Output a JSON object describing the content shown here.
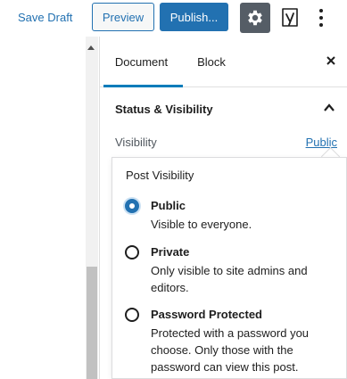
{
  "toolbar": {
    "save_draft": "Save Draft",
    "preview": "Preview",
    "publish": "Publish..."
  },
  "sidebar": {
    "tabs": [
      {
        "label": "Document",
        "active": true
      },
      {
        "label": "Block",
        "active": false
      }
    ],
    "panel_title": "Status & Visibility",
    "visibility_label": "Visibility",
    "visibility_value": "Public"
  },
  "popover": {
    "title": "Post Visibility",
    "options": [
      {
        "label": "Public",
        "description": "Visible to everyone.",
        "checked": true
      },
      {
        "label": "Private",
        "description": "Only visible to site admins and editors.",
        "checked": false
      },
      {
        "label": "Password Protected",
        "description": "Protected with a password you choose. Only those with the password can view this post.",
        "checked": false
      }
    ]
  },
  "colors": {
    "accent": "#2271b1",
    "tab_indicator": "#007cba",
    "settings_bg": "#555d66"
  },
  "icons": [
    "gear-icon",
    "yoast-icon",
    "more-vertical-icon",
    "close-icon",
    "chevron-up-icon",
    "scroll-up-arrow-icon"
  ]
}
